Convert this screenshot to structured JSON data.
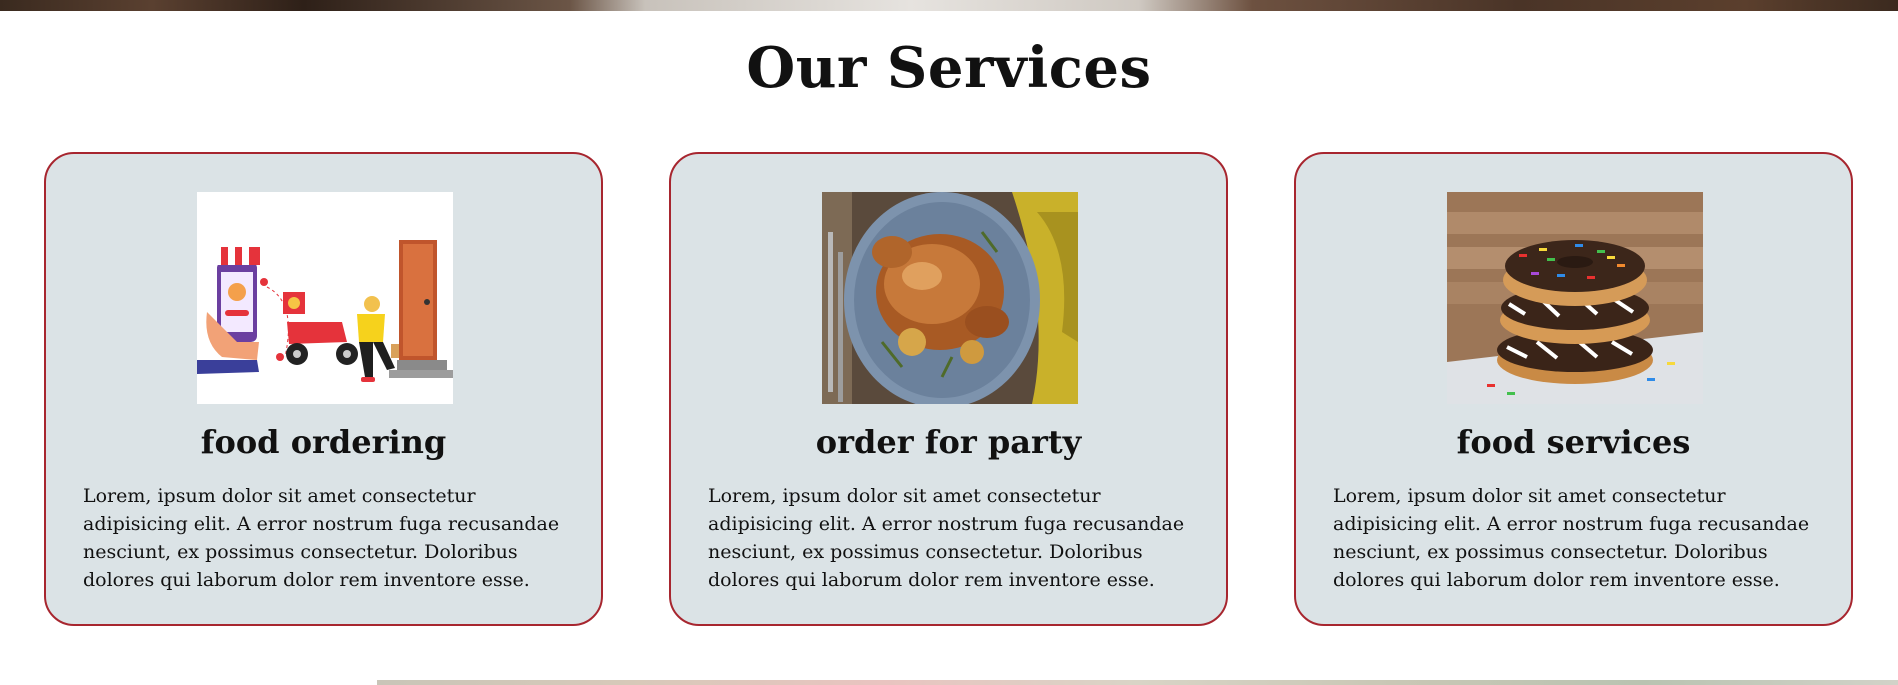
{
  "section": {
    "title": "Our Services"
  },
  "colors": {
    "card_background": "#dbe3e6",
    "card_border": "#a7262f"
  },
  "services": [
    {
      "title": "food ordering",
      "image": "delivery-illustration",
      "text": "Lorem, ipsum dolor sit amet consectetur adipisicing elit. A error nostrum fuga recusandae nesciunt, ex possimus consectetur. Doloribus dolores qui laborum dolor rem inventore esse."
    },
    {
      "title": "order for party",
      "image": "roast-chicken-photo",
      "text": "Lorem, ipsum dolor sit amet consectetur adipisicing elit. A error nostrum fuga recusandae nesciunt, ex possimus consectetur. Doloribus dolores qui laborum dolor rem inventore esse."
    },
    {
      "title": "food services",
      "image": "donuts-photo",
      "text": "Lorem, ipsum dolor sit amet consectetur adipisicing elit. A error nostrum fuga recusandae nesciunt, ex possimus consectetur. Doloribus dolores qui laborum dolor rem inventore esse."
    }
  ]
}
